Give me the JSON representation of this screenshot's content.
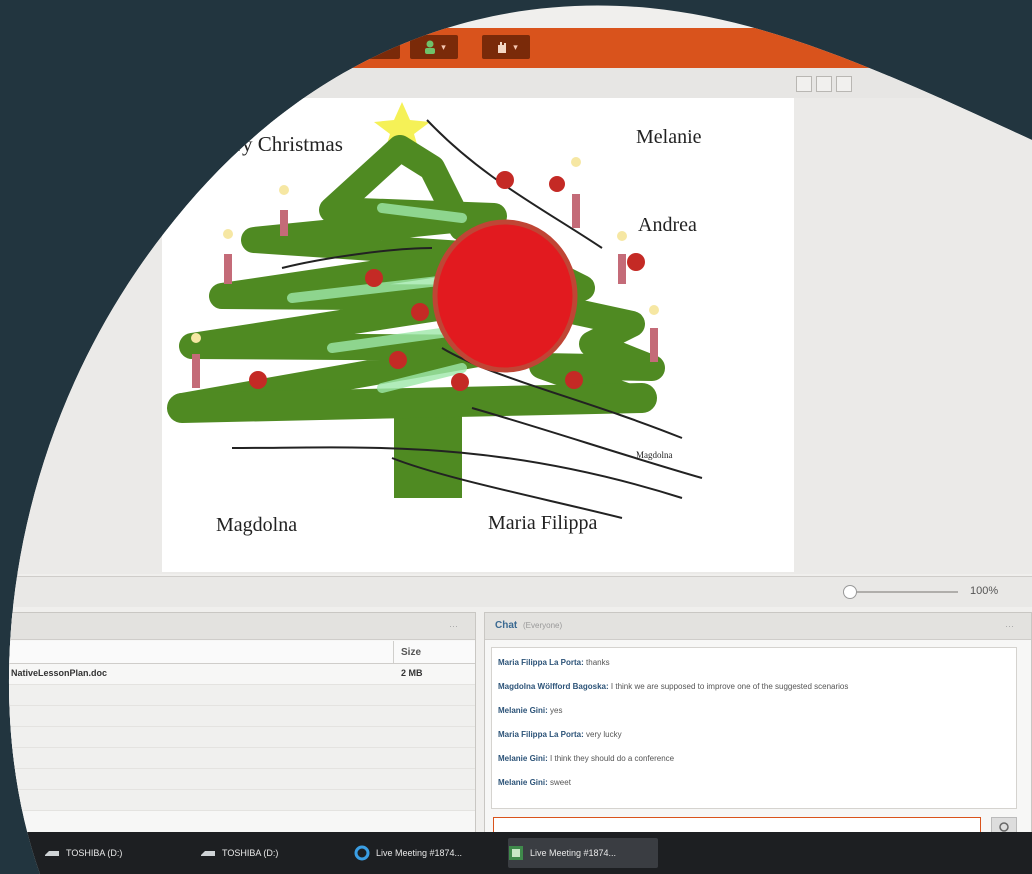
{
  "slide": {
    "greeting": "Merry Christmas",
    "names": {
      "top_right": "Melanie",
      "mid_right": "Andrea",
      "bottom_left": "Magdolna",
      "bottom_center": "Maria Filippa",
      "small_right": "Magdolna"
    }
  },
  "zoom": {
    "label": "100%"
  },
  "files": {
    "columns": {
      "size": "Size"
    },
    "rows": [
      {
        "name": "NativeLessonPlan.doc",
        "size": "2 MB"
      },
      {
        "name": "",
        "size": ""
      },
      {
        "name": "",
        "size": ""
      },
      {
        "name": "",
        "size": ""
      },
      {
        "name": "",
        "size": ""
      },
      {
        "name": "",
        "size": ""
      },
      {
        "name": "",
        "size": ""
      }
    ]
  },
  "chat": {
    "title": "Chat",
    "subtitle": "(Everyone)",
    "messages": [
      {
        "sender": "Maria Filippa La Porta:",
        "text": "thanks"
      },
      {
        "sender": "Magdolna Wölfford Bagoska:",
        "text": "I think we are supposed to improve one of the suggested scenarios"
      },
      {
        "sender": "Melanie Gini:",
        "text": "yes"
      },
      {
        "sender": "Maria Filippa La Porta:",
        "text": "very lucky"
      },
      {
        "sender": "Melanie Gini:",
        "text": "I think they should do a conference"
      },
      {
        "sender": "Melanie Gini:",
        "text": "sweet"
      }
    ]
  },
  "taskbar": {
    "items": [
      {
        "label": "TOSHIBA (D:)",
        "icon": "drive-icon"
      },
      {
        "label": "TOSHIBA (D:)",
        "icon": "drive-icon"
      },
      {
        "label": "Live Meeting #1874...",
        "icon": "ie-icon"
      },
      {
        "label": "Live Meeting #1874...",
        "icon": "live-meeting-icon"
      }
    ]
  },
  "colors": {
    "toolbar": "#d9531c",
    "background": "#22353f",
    "chat_accent": "#2c5378"
  }
}
